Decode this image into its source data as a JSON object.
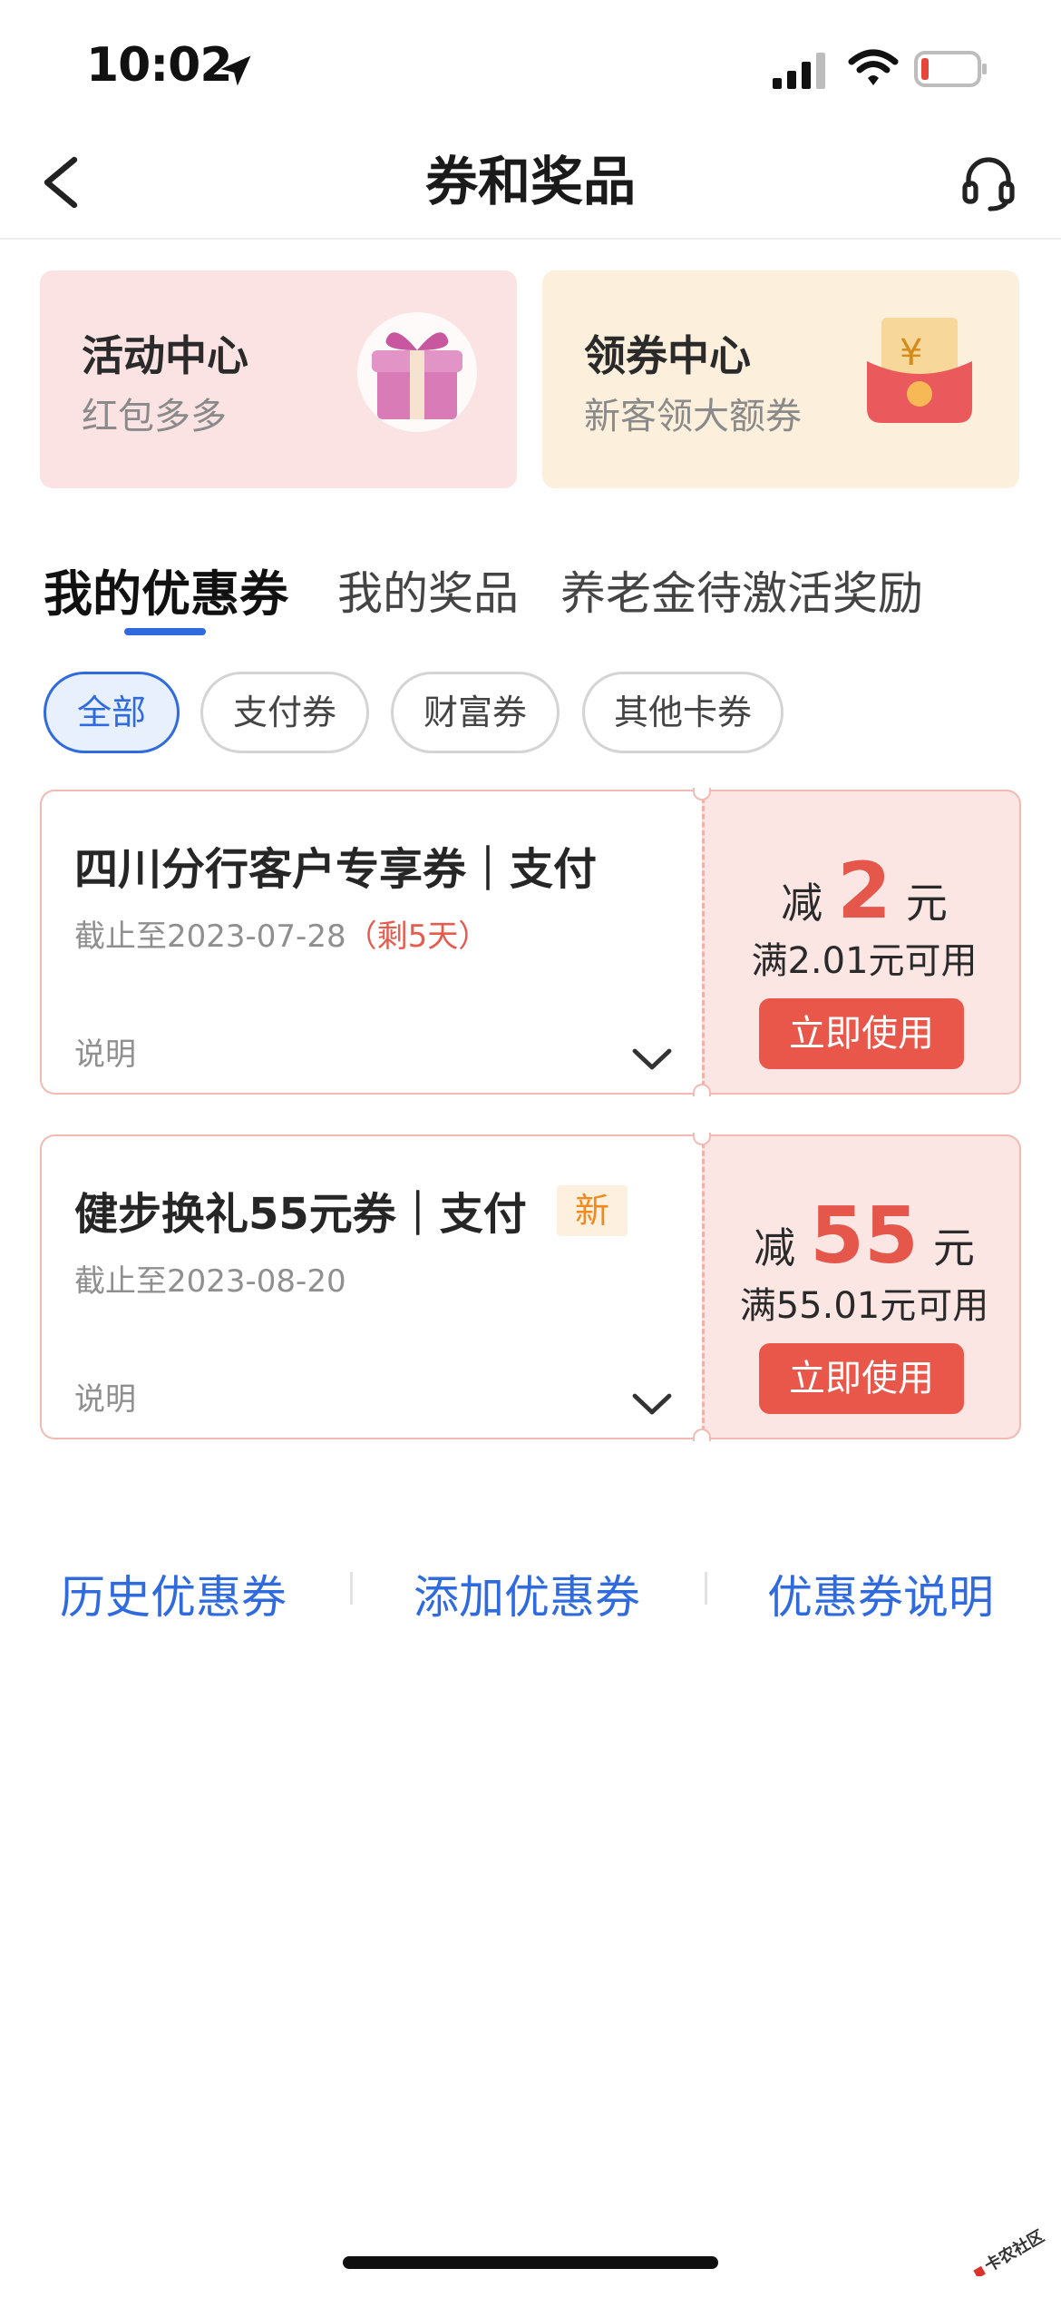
{
  "status_bar": {
    "time": "10:02"
  },
  "nav": {
    "title": "券和奖品"
  },
  "entries": [
    {
      "title": "活动中心",
      "subtitle": "红包多多",
      "icon": "gift-box-icon"
    },
    {
      "title": "领券中心",
      "subtitle": "新客领大额券",
      "icon": "red-envelope-icon"
    }
  ],
  "tabs": [
    {
      "label": "我的优惠券",
      "active": true
    },
    {
      "label": "我的奖品",
      "active": false
    },
    {
      "label": "养老金待激活奖励",
      "active": false
    }
  ],
  "filters": [
    {
      "label": "全部",
      "active": true
    },
    {
      "label": "支付券",
      "active": false
    },
    {
      "label": "财富券",
      "active": false
    },
    {
      "label": "其他卡券",
      "active": false
    }
  ],
  "coupons": [
    {
      "name": "四川分行客户专享券｜支付",
      "expiry": "截止至2023-07-28",
      "remaining": "（剩5天）",
      "desc_label": "说明",
      "amount_prefix": "减",
      "amount": "2",
      "amount_unit": "元",
      "condition": "满2.01元可用",
      "use_label": "立即使用"
    },
    {
      "name": "健步换礼55元券｜支付",
      "badge": "新",
      "expiry": "截止至2023-08-20",
      "desc_label": "说明",
      "amount_prefix": "减",
      "amount": "55",
      "amount_unit": "元",
      "condition": "满55.01元可用",
      "use_label": "立即使用"
    }
  ],
  "bottom_links": [
    "历史优惠券",
    "添加优惠券",
    "优惠券说明"
  ],
  "watermark": {
    "text": "卡农社区"
  },
  "colors": {
    "accent_blue": "#2f6bdf",
    "coupon_red": "#e9564a",
    "coupon_bg": "#fbe6e4"
  }
}
